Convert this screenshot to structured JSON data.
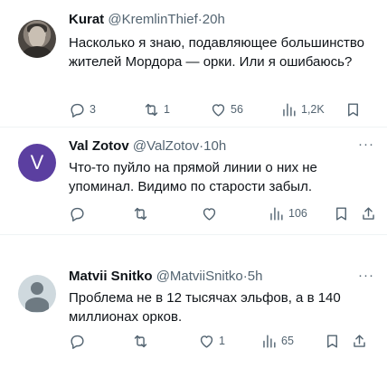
{
  "tweets": [
    {
      "name": "Kurat",
      "handle": "@KremlinThief",
      "dot": "·",
      "time": "20h",
      "text": "Насколько я знаю, подавляющее большинство жителей Мордора — орки. Или я ошибаюсь?",
      "replies": "3",
      "retweets": "1",
      "likes": "56",
      "views": "1,2K"
    },
    {
      "name": "Val Zotov",
      "handle": "@ValZotov",
      "dot": "·",
      "time": "10h",
      "avatar_letter": "V",
      "more": "···",
      "text": "Что-то пуйло на прямой линии о них не упоминал. Видимо по старости забыл.",
      "replies": "",
      "retweets": "",
      "likes": "",
      "views": "106"
    },
    {
      "name": "Matvii Snitko",
      "handle": "@MatviiSnitko",
      "dot": "·",
      "time": "5h",
      "more": "···",
      "text": "Проблема не в 12 тысячах эльфов, а в 140 миллионах орков.",
      "replies": "",
      "retweets": "",
      "likes": "1",
      "views": "65"
    }
  ],
  "colors": {
    "text": "#0f1419",
    "secondary": "#536471",
    "avatar_v": "#5b3fa0",
    "divider": "#eff3f4"
  }
}
